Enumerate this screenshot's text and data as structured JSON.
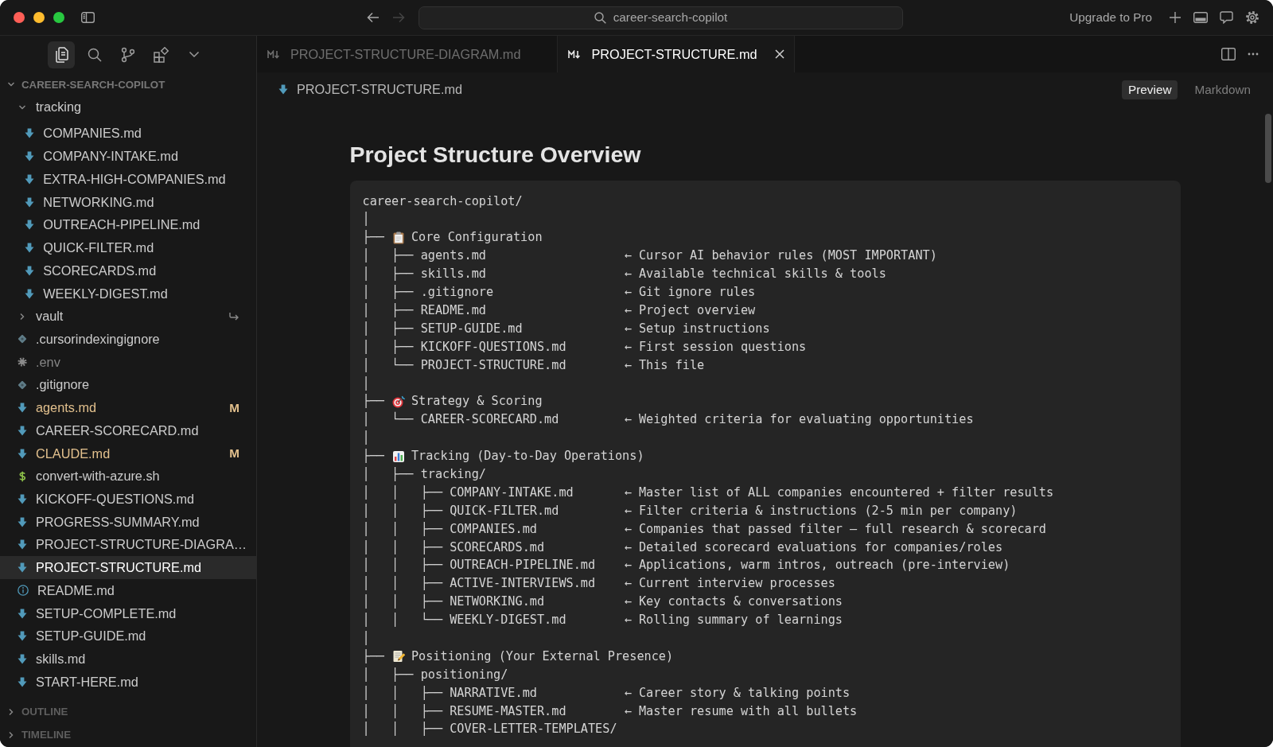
{
  "title_bar": {
    "navigation": [
      {
        "kind": "back",
        "disabled": false
      },
      {
        "kind": "forward",
        "disabled": true
      }
    ],
    "command_center": "career-search-copilot",
    "upgrade_button": "Upgrade to Pro"
  },
  "activity_bar": [
    {
      "selected": true
    },
    {
      "selected": false
    },
    {
      "selected": false
    },
    {
      "selected": false
    }
  ],
  "explorer": {
    "title": "CAREER-SEARCH-COPILOT",
    "expanded": true,
    "items": [
      {
        "kind": "folder",
        "name": "tracking",
        "expanded": true,
        "selected": false,
        "modified": false,
        "ignored": false,
        "children": [
          {
            "kind": "markdown",
            "name": "COMPANIES.md",
            "selected": false,
            "modified": false,
            "ignored": false
          },
          {
            "kind": "markdown",
            "name": "COMPANY-INTAKE.md",
            "selected": false,
            "modified": false,
            "ignored": false
          },
          {
            "kind": "markdown",
            "name": "EXTRA-HIGH-COMPANIES.md",
            "selected": false,
            "modified": false,
            "ignored": false
          },
          {
            "kind": "markdown",
            "name": "NETWORKING.md",
            "selected": false,
            "modified": false,
            "ignored": false
          },
          {
            "kind": "markdown",
            "name": "OUTREACH-PIPELINE.md",
            "selected": false,
            "modified": false,
            "ignored": false
          },
          {
            "kind": "markdown",
            "name": "QUICK-FILTER.md",
            "selected": false,
            "modified": false,
            "ignored": false
          },
          {
            "kind": "markdown",
            "name": "SCORECARDS.md",
            "selected": false,
            "modified": false,
            "ignored": false
          },
          {
            "kind": "markdown",
            "name": "WEEKLY-DIGEST.md",
            "selected": false,
            "modified": false,
            "ignored": false
          }
        ]
      },
      {
        "kind": "symlink",
        "name": "vault",
        "expanded": false,
        "selected": false,
        "modified": false,
        "ignored": false
      },
      {
        "kind": "config",
        "name": ".cursorindexingignore",
        "selected": false,
        "modified": false,
        "ignored": false
      },
      {
        "kind": "settings",
        "name": ".env",
        "selected": false,
        "modified": false,
        "ignored": true
      },
      {
        "kind": "config",
        "name": ".gitignore",
        "selected": false,
        "modified": false,
        "ignored": false
      },
      {
        "kind": "markdown",
        "name": "agents.md",
        "selected": false,
        "modified": true,
        "ignored": false,
        "badge": "M"
      },
      {
        "kind": "markdown",
        "name": "CAREER-SCORECARD.md",
        "selected": false,
        "modified": false,
        "ignored": false
      },
      {
        "kind": "markdown",
        "name": "CLAUDE.md",
        "selected": false,
        "modified": true,
        "ignored": false,
        "badge": "M"
      },
      {
        "kind": "script",
        "name": "convert-with-azure.sh",
        "selected": false,
        "modified": false,
        "ignored": false
      },
      {
        "kind": "markdown",
        "name": "KICKOFF-QUESTIONS.md",
        "selected": false,
        "modified": false,
        "ignored": false
      },
      {
        "kind": "markdown",
        "name": "PROGRESS-SUMMARY.md",
        "selected": false,
        "modified": false,
        "ignored": false
      },
      {
        "kind": "markdown",
        "name": "PROJECT-STRUCTURE-DIAGRA…",
        "selected": false,
        "modified": false,
        "ignored": false
      },
      {
        "kind": "markdown",
        "name": "PROJECT-STRUCTURE.md",
        "selected": true,
        "modified": false,
        "ignored": false
      },
      {
        "kind": "readme",
        "name": "README.md",
        "selected": false,
        "modified": false,
        "ignored": false
      },
      {
        "kind": "markdown",
        "name": "SETUP-COMPLETE.md",
        "selected": false,
        "modified": false,
        "ignored": false
      },
      {
        "kind": "markdown",
        "name": "SETUP-GUIDE.md",
        "selected": false,
        "modified": false,
        "ignored": false
      },
      {
        "kind": "markdown",
        "name": "skills.md",
        "selected": false,
        "modified": false,
        "ignored": false
      },
      {
        "kind": "markdown",
        "name": "START-HERE.md",
        "selected": false,
        "modified": false,
        "ignored": false
      }
    ]
  },
  "sidebar_sections": [
    {
      "title": "OUTLINE",
      "expanded": false
    },
    {
      "title": "TIMELINE",
      "expanded": false
    }
  ],
  "tabs": [
    {
      "label": "PROJECT-STRUCTURE-DIAGRAM.md",
      "selected": false
    },
    {
      "label": "PROJECT-STRUCTURE.md",
      "selected": true
    }
  ],
  "breadcrumb": "PROJECT-STRUCTURE.md",
  "view_toggle": [
    {
      "label": "Preview",
      "selected": true
    },
    {
      "label": "Markdown",
      "selected": false
    }
  ],
  "document": {
    "title": "Project Structure Overview",
    "code_block": {
      "lines": [
        {
          "kind": "root",
          "text": "career-search-copilot/"
        },
        {
          "kind": "guide",
          "text": "│"
        },
        {
          "kind": "section",
          "branch": "├──",
          "label": "Core Configuration"
        },
        {
          "kind": "entry",
          "text": "│   ├── agents.md",
          "note": "← Cursor AI behavior rules (MOST IMPORTANT)"
        },
        {
          "kind": "entry",
          "text": "│   ├── skills.md",
          "note": "← Available technical skills & tools"
        },
        {
          "kind": "entry",
          "text": "│   ├── .gitignore",
          "note": "← Git ignore rules"
        },
        {
          "kind": "entry",
          "text": "│   ├── README.md",
          "note": "← Project overview"
        },
        {
          "kind": "entry",
          "text": "│   ├── SETUP-GUIDE.md",
          "note": "← Setup instructions"
        },
        {
          "kind": "entry",
          "text": "│   ├── KICKOFF-QUESTIONS.md",
          "note": "← First session questions"
        },
        {
          "kind": "entry",
          "text": "│   └── PROJECT-STRUCTURE.md",
          "note": "← This file"
        },
        {
          "kind": "guide",
          "text": "│"
        },
        {
          "kind": "section",
          "branch": "├──",
          "label": "Strategy & Scoring"
        },
        {
          "kind": "entry",
          "text": "│   └── CAREER-SCORECARD.md",
          "note": "← Weighted criteria for evaluating opportunities"
        },
        {
          "kind": "guide",
          "text": "│"
        },
        {
          "kind": "section",
          "branch": "├──",
          "label": "Tracking (Day-to-Day Operations)"
        },
        {
          "kind": "entry",
          "text": "│   ├── tracking/"
        },
        {
          "kind": "entry",
          "text": "│   │   ├── COMPANY-INTAKE.md",
          "note": "← Master list of ALL companies encountered + filter results"
        },
        {
          "kind": "entry",
          "text": "│   │   ├── QUICK-FILTER.md",
          "note": "← Filter criteria & instructions (2-5 min per company)"
        },
        {
          "kind": "entry",
          "text": "│   │   ├── COMPANIES.md",
          "note": "← Companies that passed filter — full research & scorecard"
        },
        {
          "kind": "entry",
          "text": "│   │   ├── SCORECARDS.md",
          "note": "← Detailed scorecard evaluations for companies/roles"
        },
        {
          "kind": "entry",
          "text": "│   │   ├── OUTREACH-PIPELINE.md",
          "note": "← Applications, warm intros, outreach (pre-interview)"
        },
        {
          "kind": "entry",
          "text": "│   │   ├── ACTIVE-INTERVIEWS.md",
          "note": "← Current interview processes"
        },
        {
          "kind": "entry",
          "text": "│   │   ├── NETWORKING.md",
          "note": "← Key contacts & conversations"
        },
        {
          "kind": "entry",
          "text": "│   │   └── WEEKLY-DIGEST.md",
          "note": "← Rolling summary of learnings"
        },
        {
          "kind": "guide",
          "text": "│"
        },
        {
          "kind": "section",
          "branch": "├──",
          "label": "Positioning (Your External Presence)"
        },
        {
          "kind": "entry",
          "text": "│   ├── positioning/"
        },
        {
          "kind": "entry",
          "text": "│   │   ├── NARRATIVE.md",
          "note": "← Career story & talking points"
        },
        {
          "kind": "entry",
          "text": "│   │   ├── RESUME-MASTER.md",
          "note": "← Master resume with all bullets"
        },
        {
          "kind": "entry",
          "text": "│   │   ├── COVER-LETTER-TEMPLATES/"
        }
      ]
    }
  }
}
